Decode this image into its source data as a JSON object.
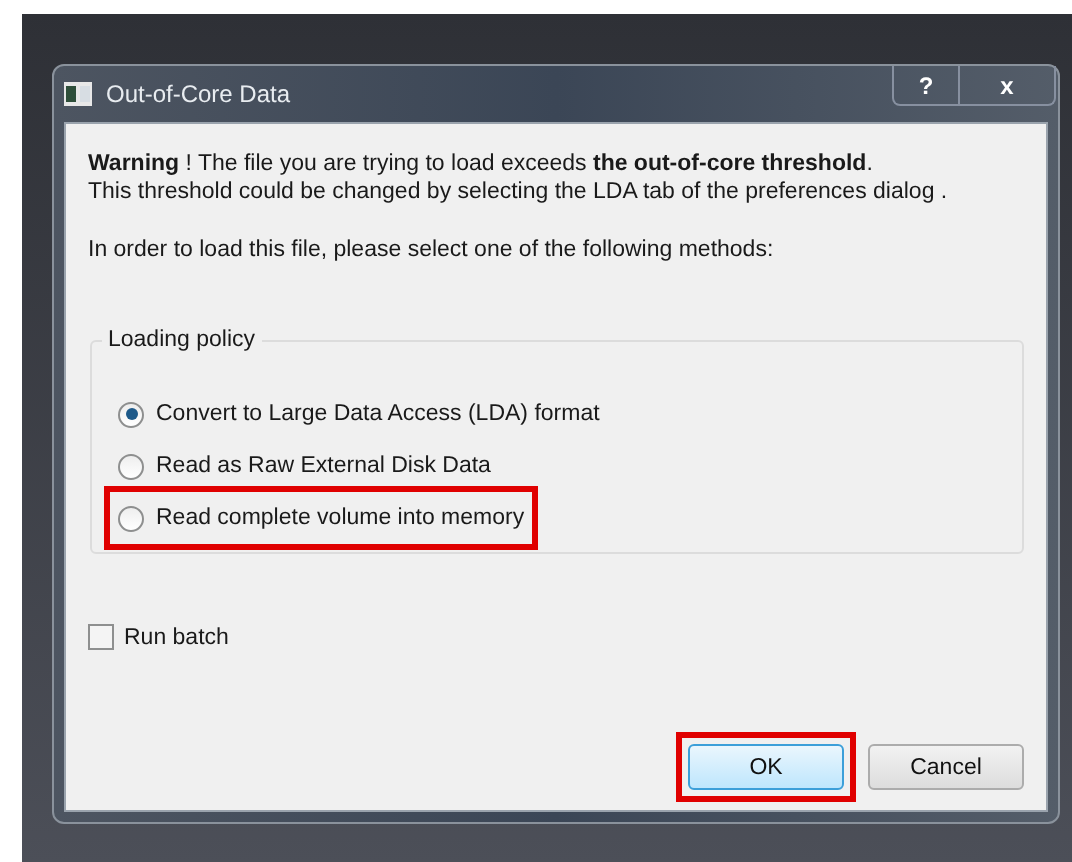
{
  "window": {
    "title": "Out-of-Core Data",
    "buttons": [
      {
        "kind": "help",
        "label": "?"
      },
      {
        "kind": "close",
        "label": "x"
      }
    ]
  },
  "message": [
    "**Warning** ! The file you are trying to load exceeds **the out-of-core threshold**.",
    "This threshold could be changed by selecting the LDA tab of the preferences dialog ."
  ],
  "instruction": "In order to load this file, please select one of the following methods:",
  "loading_policy": {
    "title": "Loading policy",
    "options": [
      {
        "label": "Convert to Large Data Access (LDA) format",
        "selected": true,
        "highlighted": false
      },
      {
        "label": "Read as Raw External Disk Data",
        "selected": false,
        "highlighted": false
      },
      {
        "label": "Read complete volume into memory",
        "selected": false,
        "highlighted": true
      }
    ]
  },
  "run_batch": {
    "label": "Run batch",
    "checked": false
  },
  "buttons": [
    {
      "label": "OK",
      "default": true,
      "highlighted": true
    },
    {
      "label": "Cancel",
      "default": false,
      "highlighted": false
    }
  ]
}
